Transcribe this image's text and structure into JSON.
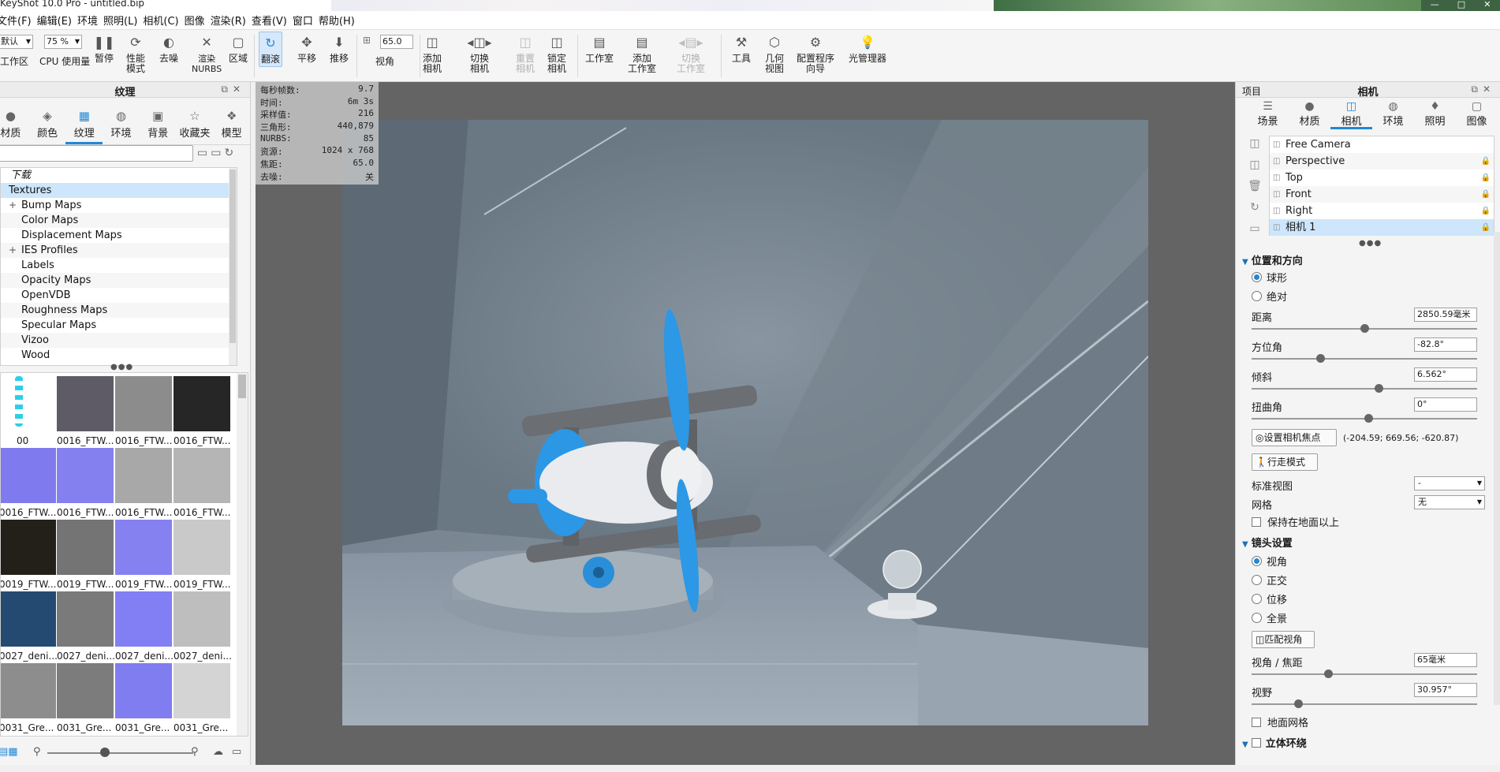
{
  "window": {
    "title": "KeyShot 10.0 Pro  - untitled.bip"
  },
  "menu": [
    "文件(F)",
    "编辑(E)",
    "环境",
    "照明(L)",
    "相机(C)",
    "图像",
    "渲染(R)",
    "查看(V)",
    "窗口",
    "帮助(H)"
  ],
  "ribbon": {
    "workspace_value": "默认",
    "workspace_label": "工作区",
    "cpu_value": "75 %",
    "cpu_label": "CPU 使用量",
    "pause": "暂停",
    "perf": "性能\n模式",
    "denoise": "去噪",
    "nurbs": "渲染\nNURBS",
    "region": "区域",
    "tumble": "翻滚",
    "pan": "平移",
    "dolly": "推移",
    "fov_value": "65.0",
    "fov": "视角",
    "add_camera": "添加\n相机",
    "switch_camera": "切换\n相机",
    "reset_camera": "重置\n相机",
    "lock_camera": "锁定\n相机",
    "studio": "工作室",
    "add_studio": "添加\n工作室",
    "switch_studio": "切换\n工作室",
    "tools": "工具",
    "geometry_view": "几何\n视图",
    "config_wizard": "配置程序\n向导",
    "light_manager": "光管理器"
  },
  "left_panel": {
    "title": "纹理",
    "tabs": [
      "材质",
      "颜色",
      "纹理",
      "环境",
      "背景",
      "收藏夹",
      "模型"
    ],
    "selected_tab": "纹理",
    "tree": [
      "下载",
      "Textures",
      "Bump Maps",
      "Color Maps",
      "Displacement Maps",
      "IES Profiles",
      "Labels",
      "Opacity Maps",
      "OpenVDB",
      "Roughness Maps",
      "Specular Maps",
      "Vizoo",
      "Wood"
    ],
    "thumbnails": [
      {
        "label": "00",
        "color": "#ffffff"
      },
      {
        "label": "0016_FTW...",
        "color": "#5e5b66"
      },
      {
        "label": "0016_FTW...",
        "color": "#8c8c8c"
      },
      {
        "label": "0016_FTW...",
        "color": "#262626"
      },
      {
        "label": "0016_FTW...",
        "color": "#7f7bef"
      },
      {
        "label": "0016_FTW...",
        "color": "#8480f0"
      },
      {
        "label": "0016_FTW...",
        "color": "#a8a8a8"
      },
      {
        "label": "0016_FTW...",
        "color": "#b5b5b5"
      },
      {
        "label": "0019_FTW...",
        "color": "#222018"
      },
      {
        "label": "0019_FTW...",
        "color": "#747474"
      },
      {
        "label": "0019_FTW...",
        "color": "#8681f1"
      },
      {
        "label": "0019_FTW...",
        "color": "#c9c9c9"
      },
      {
        "label": "0027_deni...",
        "color": "#244a72"
      },
      {
        "label": "0027_deni...",
        "color": "#7a7a7a"
      },
      {
        "label": "0027_deni...",
        "color": "#827ef3"
      },
      {
        "label": "0027_deni...",
        "color": "#bebebe"
      },
      {
        "label": "0031_Gre...",
        "color": "#8d8d8d"
      },
      {
        "label": "0031_Gre...",
        "color": "#7c7c7c"
      },
      {
        "label": "0031_Gre...",
        "color": "#807df1"
      },
      {
        "label": "0031_Gre...",
        "color": "#d4d4d4"
      }
    ]
  },
  "stats": [
    {
      "k": "每秒帧数:",
      "v": "9.7"
    },
    {
      "k": "时间:",
      "v": "6m 3s"
    },
    {
      "k": "采样值:",
      "v": "216"
    },
    {
      "k": "三角形:",
      "v": "440,879"
    },
    {
      "k": "NURBS:",
      "v": "85"
    },
    {
      "k": "资源:",
      "v": "1024 x 768"
    },
    {
      "k": "焦距:",
      "v": "65.0"
    },
    {
      "k": "去噪:",
      "v": "关"
    }
  ],
  "right_panel": {
    "project_label": "项目",
    "title": "相机",
    "tabs": [
      "场景",
      "材质",
      "相机",
      "环境",
      "照明",
      "图像"
    ],
    "selected_tab": "相机",
    "cameras": [
      "Free Camera",
      "Perspective",
      "Top",
      "Front",
      "Right",
      "相机 1"
    ],
    "section_position": "位置和方向",
    "mode_spherical": "球形",
    "mode_absolute": "绝对",
    "distance_label": "距离",
    "distance_value": "2850.59毫米",
    "azimuth_label": "方位角",
    "azimuth_value": "-82.8°",
    "inclination_label": "倾斜",
    "inclination_value": "6.562°",
    "twist_label": "扭曲角",
    "twist_value": "0°",
    "set_focus_btn": "设置相机焦点",
    "focus_coords": "(-204.59; 669.56; -620.87)",
    "walk_btn": "行走模式",
    "std_view_label": "标准视图",
    "std_view_value": "-",
    "grid_label": "网格",
    "grid_value": "无",
    "keep_above_ground": "保持在地面以上",
    "section_lens": "镜头设置",
    "lens_fov": "视角",
    "lens_ortho": "正交",
    "lens_shift": "位移",
    "lens_panorama": "全景",
    "match_persp_btn": "匹配视角",
    "fov_focal_label": "视角 / 焦距",
    "fov_focal_value": "65毫米",
    "fov_label": "视野",
    "fov_value": "30.957°",
    "ground_grid": "地面网格",
    "section_stereo": "立体环绕"
  }
}
